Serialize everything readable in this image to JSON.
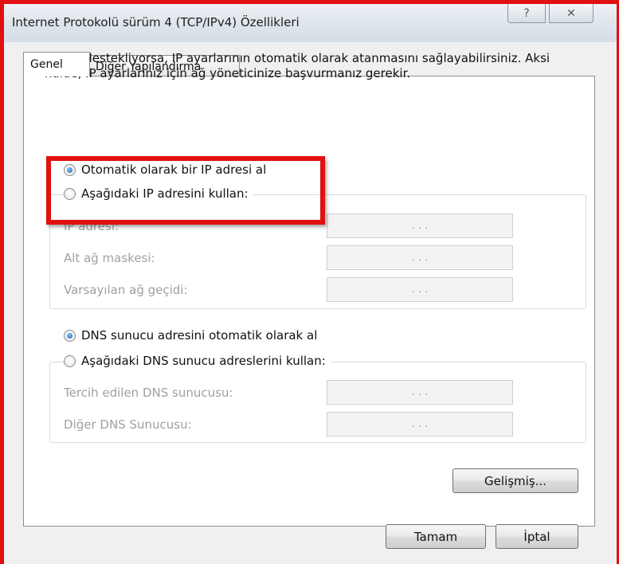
{
  "window": {
    "title": "Internet Protokolü sürüm 4 (TCP/IPv4) Özellikleri",
    "help_glyph": "?",
    "close_glyph": "✕"
  },
  "tabs": [
    {
      "label": "Genel",
      "active": true
    },
    {
      "label": "Diğer Yapılandırma",
      "active": false
    }
  ],
  "description": "Ağınız destekliyorsa, IP ayarlarının otomatik olarak atanmasını sağlayabilirsiniz. Aksi halde, IP ayarlarınız için ağ yöneticinize başvurmanız gerekir.",
  "ip": {
    "auto_label": "Otomatik olarak bir IP adresi al",
    "manual_label": "Aşağıdaki IP adresini kullan:",
    "auto_selected": true,
    "fields": [
      {
        "label": "IP adresi:",
        "value": ".   .   ."
      },
      {
        "label": "Alt ağ maskesi:",
        "value": ".   .   ."
      },
      {
        "label": "Varsayılan ağ geçidi:",
        "value": ".   .   ."
      }
    ]
  },
  "dns": {
    "auto_label": "DNS sunucu adresini otomatik olarak al",
    "manual_label": "Aşağıdaki DNS sunucu adreslerini kullan:",
    "auto_selected": true,
    "fields": [
      {
        "label": "Tercih edilen DNS sunucusu:",
        "value": ".   .   ."
      },
      {
        "label": "Diğer DNS Sunucusu:",
        "value": ".   .   ."
      }
    ]
  },
  "buttons": {
    "advanced": "Gelişmiş...",
    "ok": "Tamam",
    "cancel": "İptal"
  },
  "colors": {
    "highlight": "#e01010",
    "radio_dot": "#1a5fb4"
  }
}
